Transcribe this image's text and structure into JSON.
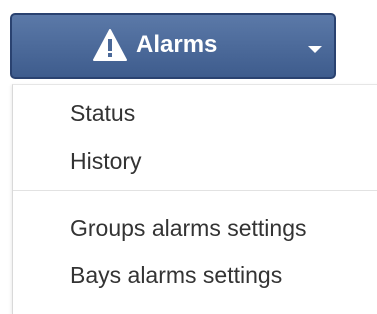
{
  "dropdown": {
    "button_label": "Alarms",
    "button_icon": "warning-icon",
    "caret_icon": "caret-down-icon",
    "colors": {
      "button_top": "#5b79a8",
      "button_bottom": "#3e5c8d",
      "button_border": "#2a4270",
      "text": "#333333"
    },
    "menu_items_group1": [
      "Status",
      "History"
    ],
    "menu_items_group2": [
      "Groups alarms settings",
      "Bays alarms settings"
    ]
  }
}
